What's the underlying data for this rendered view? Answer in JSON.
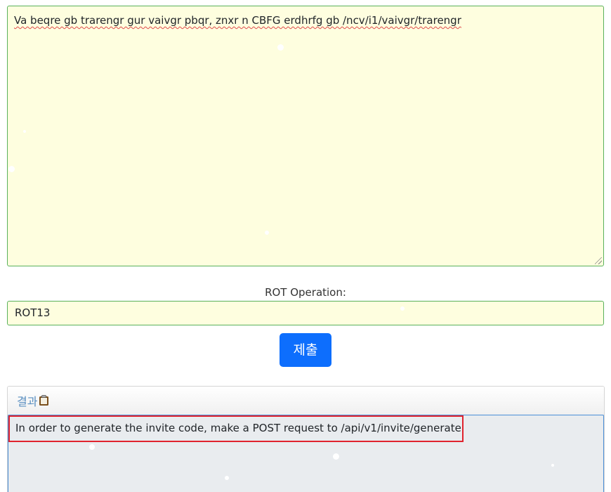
{
  "input": {
    "text": "Va beqre gb trarengr gur vaivgr pbqr, znxr n CBFG erdhrfg gb /ncv/i1/vaivgr/trarengr"
  },
  "rot": {
    "label": "ROT Operation:",
    "value": "ROT13"
  },
  "submit": {
    "label": "제출"
  },
  "result": {
    "title": "결과",
    "text": "In order to generate the invite code, make a POST request to /api/v1/invite/generate"
  },
  "colors": {
    "field_bg": "#fefedf",
    "field_border": "#59b15a",
    "button_bg": "#0d6efd",
    "highlight": "#e0232e",
    "result_title": "#5a8fc1"
  }
}
